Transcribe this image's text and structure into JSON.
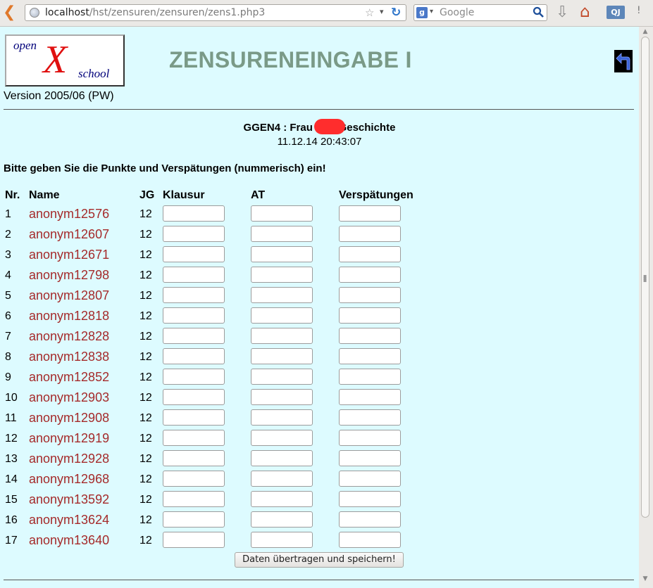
{
  "browser": {
    "url_host": "localhost",
    "url_path": "/hst/zensuren/zensuren/zens1.php3",
    "search_placeholder": "Google",
    "search_engine_icon": "g-icon",
    "addon_label": "QJ"
  },
  "header": {
    "logo": {
      "word_open": "open",
      "word_x": "X",
      "word_school": "school"
    },
    "version": "Version 2005/06 (PW)",
    "title": "ZENSURENEINGABE I",
    "title_color": "#7a9a87"
  },
  "course": {
    "class_line": "GGEN4 : Frau Be      : Geschichte",
    "datetime": "11.12.14 20:43:07"
  },
  "instruction": "Bitte geben Sie die Punkte und Verspätungen (nummerisch) ein!",
  "table": {
    "headers": {
      "nr": "Nr.",
      "name": "Name",
      "jg": "JG",
      "klausur": "Klausur",
      "at": "AT",
      "verspaetungen": "Verspätungen"
    },
    "rows": [
      {
        "nr": "1",
        "name": "anonym12576",
        "jg": "12",
        "klausur": "",
        "at": "",
        "verspaetungen": ""
      },
      {
        "nr": "2",
        "name": "anonym12607",
        "jg": "12",
        "klausur": "",
        "at": "",
        "verspaetungen": ""
      },
      {
        "nr": "3",
        "name": "anonym12671",
        "jg": "12",
        "klausur": "",
        "at": "",
        "verspaetungen": ""
      },
      {
        "nr": "4",
        "name": "anonym12798",
        "jg": "12",
        "klausur": "",
        "at": "",
        "verspaetungen": ""
      },
      {
        "nr": "5",
        "name": "anonym12807",
        "jg": "12",
        "klausur": "",
        "at": "",
        "verspaetungen": ""
      },
      {
        "nr": "6",
        "name": "anonym12818",
        "jg": "12",
        "klausur": "",
        "at": "",
        "verspaetungen": ""
      },
      {
        "nr": "7",
        "name": "anonym12828",
        "jg": "12",
        "klausur": "",
        "at": "",
        "verspaetungen": ""
      },
      {
        "nr": "8",
        "name": "anonym12838",
        "jg": "12",
        "klausur": "",
        "at": "",
        "verspaetungen": ""
      },
      {
        "nr": "9",
        "name": "anonym12852",
        "jg": "12",
        "klausur": "",
        "at": "",
        "verspaetungen": ""
      },
      {
        "nr": "10",
        "name": "anonym12903",
        "jg": "12",
        "klausur": "",
        "at": "",
        "verspaetungen": ""
      },
      {
        "nr": "11",
        "name": "anonym12908",
        "jg": "12",
        "klausur": "",
        "at": "",
        "verspaetungen": ""
      },
      {
        "nr": "12",
        "name": "anonym12919",
        "jg": "12",
        "klausur": "",
        "at": "",
        "verspaetungen": ""
      },
      {
        "nr": "13",
        "name": "anonym12928",
        "jg": "12",
        "klausur": "",
        "at": "",
        "verspaetungen": ""
      },
      {
        "nr": "14",
        "name": "anonym12968",
        "jg": "12",
        "klausur": "",
        "at": "",
        "verspaetungen": ""
      },
      {
        "nr": "15",
        "name": "anonym13592",
        "jg": "12",
        "klausur": "",
        "at": "",
        "verspaetungen": ""
      },
      {
        "nr": "16",
        "name": "anonym13624",
        "jg": "12",
        "klausur": "",
        "at": "",
        "verspaetungen": ""
      },
      {
        "nr": "17",
        "name": "anonym13640",
        "jg": "12",
        "klausur": "",
        "at": "",
        "verspaetungen": ""
      }
    ]
  },
  "submit_label": "Daten übertragen und speichern!",
  "colors": {
    "page_bg": "#ddfbff",
    "name_link": "#a52a2a",
    "logo_x": "#e01010",
    "logo_text": "#00007a"
  }
}
